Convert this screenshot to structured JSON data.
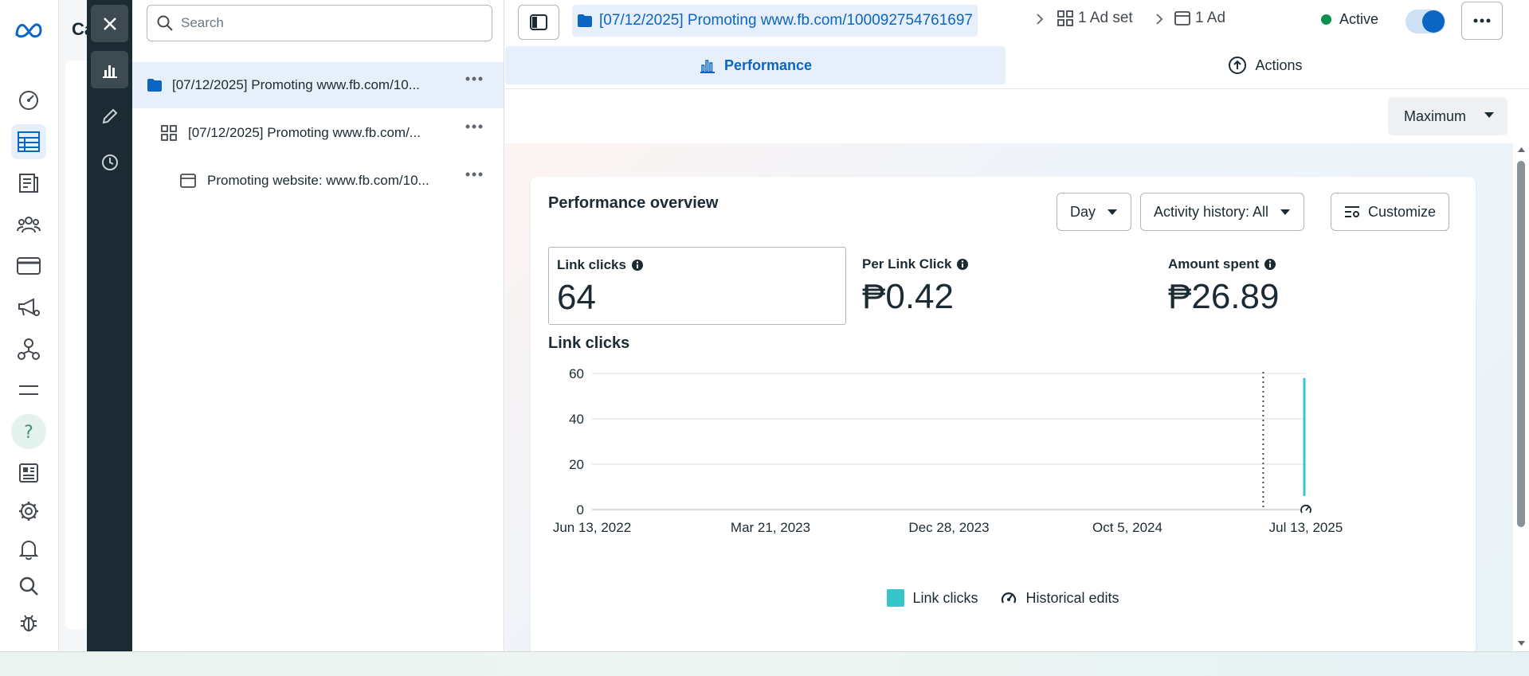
{
  "underlying_page": {
    "title_fragment": "Ca"
  },
  "tree": {
    "search_placeholder": "Search",
    "items": [
      {
        "label": "[07/12/2025] Promoting www.fb.com/10...",
        "type": "campaign"
      },
      {
        "label": "[07/12/2025] Promoting www.fb.com/...",
        "type": "ad-set"
      },
      {
        "label": "Promoting website: www.fb.com/10...",
        "type": "ad"
      }
    ]
  },
  "breadcrumb": {
    "campaign": "[07/12/2025] Promoting www.fb.com/100092754761697",
    "adset": "1 Ad set",
    "ad": "1 Ad"
  },
  "status": {
    "label": "Active",
    "toggle_on": true,
    "color": "#0a8f4e"
  },
  "tabs": [
    {
      "label": "Performance",
      "active": true
    },
    {
      "label": "Actions",
      "active": false
    }
  ],
  "date_range": "Maximum",
  "overview": {
    "title": "Performance overview",
    "granularity": "Day",
    "activity_filter": "Activity history: All",
    "customize_label": "Customize",
    "metrics": [
      {
        "label": "Link clicks",
        "value": "64"
      },
      {
        "label": "Per Link Click",
        "value": "₱0.42"
      },
      {
        "label": "Amount spent",
        "value": "₱26.89"
      }
    ]
  },
  "chart_data": {
    "type": "line",
    "title": "Link clicks",
    "xlabel": "",
    "ylabel": "",
    "x_tick_labels": [
      "Jun 13, 2022",
      "Mar 21, 2023",
      "Dec 28, 2023",
      "Oct 5, 2024",
      "Jul 13, 2025"
    ],
    "xlim": [
      "2022-06-13",
      "2025-07-13"
    ],
    "yticks": [
      0,
      20,
      40,
      60
    ],
    "ylim": [
      0,
      60
    ],
    "grid": true,
    "series": [
      {
        "name": "Link clicks",
        "color": "#34c6c8",
        "points": [
          [
            "2025-07-12",
            6
          ],
          [
            "2025-07-12",
            58
          ]
        ]
      }
    ],
    "markers": [
      {
        "type": "historical-edit",
        "x": "2025-07-13"
      },
      {
        "type": "dotted-vline",
        "x": "2025-04-25"
      }
    ],
    "legend": [
      "Link clicks",
      "Historical edits"
    ],
    "legend_position": "bottom"
  },
  "colors": {
    "accent": "#0a66c2",
    "series": "#34c6c8",
    "strip": "#1c2b33"
  }
}
